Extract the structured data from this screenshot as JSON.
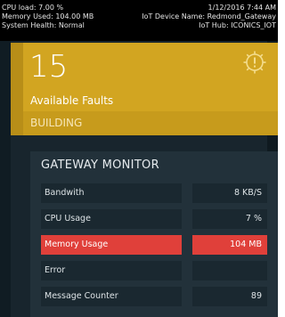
{
  "status_bar": {
    "cpu_load": "CPU load: 7.00 %",
    "memory_used": "Memory Used: 104.00 MB",
    "system_health": "System Health: Normal",
    "date_time": "1/12/2016 7:44 AM",
    "device_name": "IoT Device Name: Redmond_Gateway",
    "iot_hub": "IoT Hub: ICONICS_IOT"
  },
  "fault_tile": {
    "count": "15",
    "label": "Available Faults",
    "category": "BUILDING",
    "icon": "gear-alert-icon",
    "color": "#d2a521"
  },
  "gateway_monitor": {
    "title": "GATEWAY MONITOR",
    "metrics": [
      {
        "name": "Bandwith",
        "value": "8 KB/S",
        "alert": false
      },
      {
        "name": "CPU Usage",
        "value": "7 %",
        "alert": false
      },
      {
        "name": "Memory Usage",
        "value": "104 MB",
        "alert": true
      },
      {
        "name": "Error",
        "value": "",
        "alert": false
      },
      {
        "name": "Message Counter",
        "value": "89",
        "alert": false
      }
    ],
    "alert_color": "#e0403a"
  }
}
